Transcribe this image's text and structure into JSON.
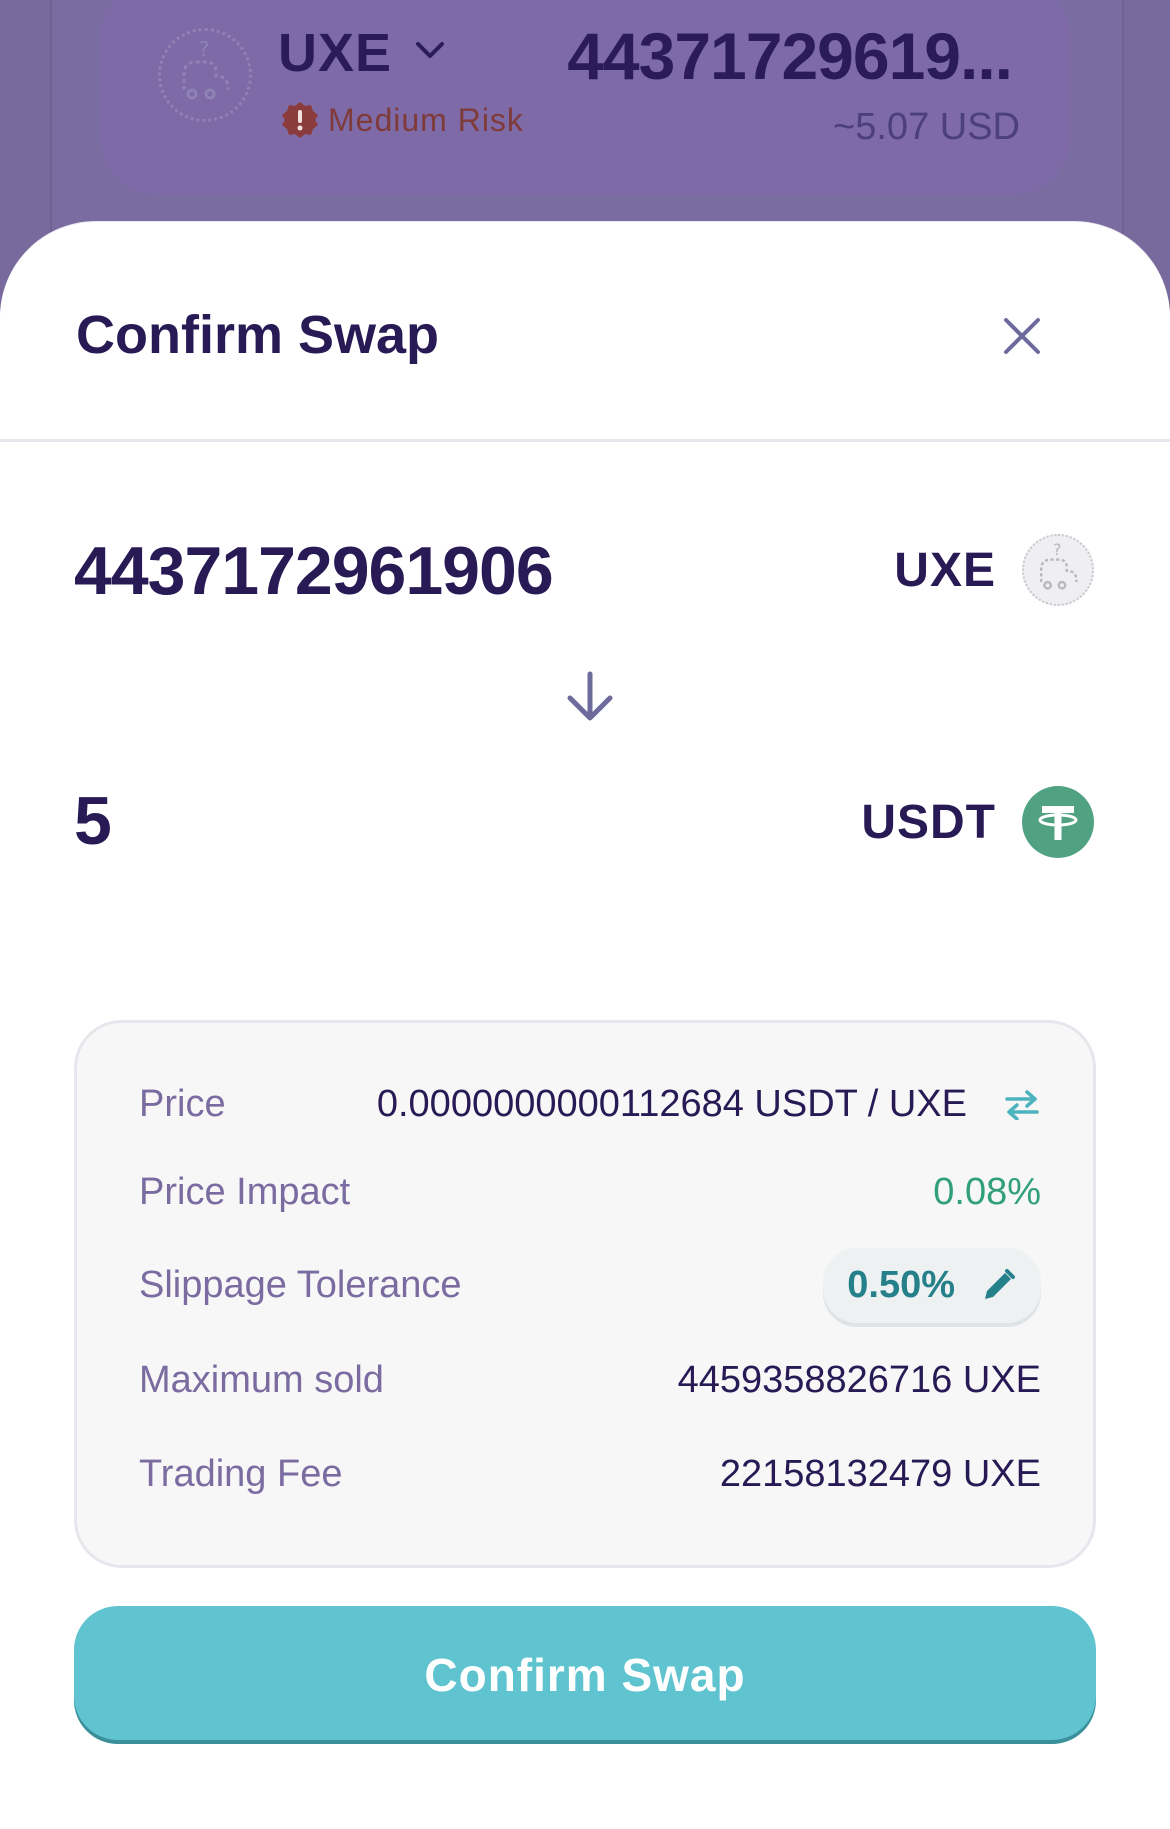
{
  "background": {
    "token_icon": "unknown-token-icon",
    "token_symbol": "UXE",
    "risk_label": "Medium Risk",
    "amount": "44371729619...",
    "usd_estimate": "~5.07 USD"
  },
  "modal": {
    "title": "Confirm Swap",
    "from": {
      "amount": "4437172961906",
      "symbol": "UXE",
      "icon": "unknown-token-icon"
    },
    "to": {
      "amount": "5",
      "symbol": "USDT",
      "icon": "tether-icon"
    },
    "details": {
      "price_label": "Price",
      "price_value": "0.0000000000112684 USDT / UXE",
      "impact_label": "Price Impact",
      "impact_value": "0.08%",
      "slippage_label": "Slippage Tolerance",
      "slippage_value": "0.50%",
      "max_sold_label": "Maximum sold",
      "max_sold_value": "4459358826716 UXE",
      "fee_label": "Trading Fee",
      "fee_value": "22158132479 UXE"
    },
    "confirm_label": "Confirm Swap"
  },
  "colors": {
    "primary_text": "#271a55",
    "muted_text": "#7a6ca0",
    "accent_teal": "#5fc4d0",
    "positive_green": "#31a078",
    "tether_green": "#50a283",
    "risk_red": "#8a3b3b"
  }
}
